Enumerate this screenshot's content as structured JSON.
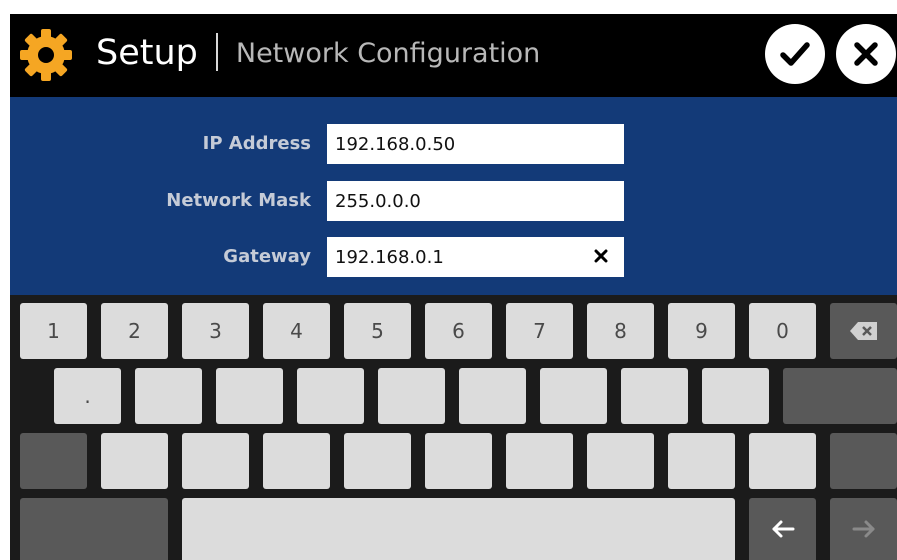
{
  "header": {
    "title": "Setup",
    "subtitle": "Network Configuration",
    "icon": "gear-icon",
    "accent_color": "#f5a623",
    "confirm_icon": "checkmark-icon",
    "cancel_icon": "close-icon"
  },
  "form": {
    "background": "#133a78",
    "fields": [
      {
        "label": "IP Address",
        "value": "192.168.0.50"
      },
      {
        "label": "Network Mask",
        "value": "255.0.0.0"
      },
      {
        "label": "Gateway",
        "value": "192.168.0.1",
        "clear_icon": "close-icon"
      }
    ]
  },
  "keyboard": {
    "row1": [
      "1",
      "2",
      "3",
      "4",
      "5",
      "6",
      "7",
      "8",
      "9",
      "0"
    ],
    "row1_end_icon": "backspace-icon",
    "row2": [
      "."
    ],
    "row4_icons": [
      "arrow-left-icon",
      "arrow-right-icon"
    ]
  }
}
